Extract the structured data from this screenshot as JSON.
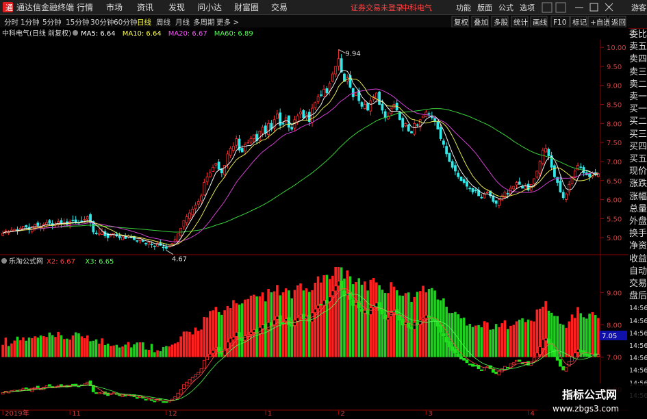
{
  "app": {
    "title": "通达信金融终端",
    "menu": [
      "行情",
      "市场",
      "资讯",
      "发现",
      "问小达",
      "财富圈",
      "交易"
    ],
    "notice": "证券交易未登录",
    "stock_name": "中科电气",
    "right_menu": [
      "功能",
      "版面",
      "公式",
      "选项"
    ],
    "user": "游客"
  },
  "toolbar": {
    "periods": [
      "分时",
      "1分钟",
      "5分钟",
      "15分钟",
      "30分钟",
      "60分钟",
      "日线",
      "周线",
      "月线",
      "多周期",
      "更多"
    ],
    "active_period": "日线",
    "tools": [
      "复权",
      "叠加",
      "多股",
      "统计",
      "画线",
      "F10",
      "标记",
      "+自选",
      "返回"
    ]
  },
  "legend_main": {
    "title": "中科电气(日线 前复权)",
    "items": [
      {
        "label": "MA5: 6.64",
        "color": "#ffffff"
      },
      {
        "label": "MA10: 6.64",
        "color": "#ffff55"
      },
      {
        "label": "MA20: 6.67",
        "color": "#ff55ff"
      },
      {
        "label": "MA60: 6.89",
        "color": "#55ff55"
      }
    ]
  },
  "legend_sub": {
    "title": "乐淘公式网",
    "items": [
      {
        "label": "X2: 6.67",
        "color": "#ff4444"
      },
      {
        "label": "X3: 6.65",
        "color": "#55ff55"
      }
    ],
    "current_value": "7.05"
  },
  "right_labels": [
    "委比",
    "卖五",
    "卖四",
    "卖三",
    "卖二",
    "卖一",
    "买一",
    "买二",
    "买三",
    "买四",
    "买五",
    "现价",
    "涨跌",
    "涨幅",
    "总量",
    "外盘",
    "换手",
    "净资",
    "收益",
    "自动",
    "交易",
    "盘后",
    "14:56",
    "14:56",
    "14:56",
    "14:56",
    "14:56",
    "14:56",
    "14:56",
    "14:56"
  ],
  "x_labels": [
    {
      "text": "2019年",
      "idx": 0
    },
    {
      "text": "11",
      "idx": 23
    },
    {
      "text": "12",
      "idx": 56
    },
    {
      "text": "1",
      "idx": 90
    },
    {
      "text": "2",
      "idx": 115
    },
    {
      "text": "3",
      "idx": 145
    },
    {
      "text": "4",
      "idx": 180
    }
  ],
  "chart_data": [
    {
      "type": "candlestick",
      "title": "中科电气(日线 前复权)",
      "ylim": [
        4.5,
        10.2
      ],
      "yticks": [
        5.0,
        5.5,
        6.0,
        6.5,
        7.0,
        7.5,
        8.0,
        8.5,
        9.0,
        9.5,
        10.0
      ],
      "annotations": [
        {
          "text": "9.94",
          "value": 9.94
        },
        {
          "text": "4.67",
          "value": 4.67
        }
      ],
      "close": [
        5.12,
        5.18,
        5.15,
        5.2,
        5.22,
        5.18,
        5.25,
        5.3,
        5.28,
        5.22,
        5.3,
        5.35,
        5.32,
        5.28,
        5.35,
        5.4,
        5.38,
        5.32,
        5.36,
        5.42,
        5.38,
        5.4,
        5.35,
        5.42,
        5.45,
        5.4,
        5.38,
        5.42,
        5.48,
        5.55,
        5.4,
        5.15,
        5.1,
        5.12,
        5.15,
        5.05,
        5.0,
        5.08,
        5.12,
        5.05,
        5.0,
        5.02,
        4.98,
        5.05,
        5.0,
        4.95,
        4.92,
        4.98,
        4.9,
        4.85,
        4.88,
        4.82,
        4.78,
        4.85,
        4.8,
        4.75,
        4.72,
        4.78,
        4.85,
        4.95,
        5.1,
        5.25,
        5.45,
        5.55,
        5.65,
        5.75,
        5.85,
        5.95,
        6.1,
        6.45,
        6.6,
        6.7,
        6.85,
        6.95,
        6.8,
        6.7,
        6.9,
        7.2,
        7.35,
        7.4,
        7.6,
        7.3,
        7.25,
        7.45,
        7.5,
        7.6,
        7.7,
        7.55,
        7.8,
        7.9,
        7.75,
        8.0,
        7.85,
        8.1,
        8.25,
        7.95,
        8.0,
        8.15,
        7.9,
        7.85,
        8.1,
        8.2,
        8.3,
        8.15,
        8.25,
        8.05,
        8.4,
        8.55,
        8.7,
        8.75,
        8.9,
        8.8,
        9.05,
        9.3,
        9.5,
        9.7,
        9.35,
        9.1,
        9.2,
        8.95,
        8.7,
        8.8,
        8.6,
        8.45,
        8.5,
        8.35,
        8.6,
        8.7,
        8.8,
        8.5,
        8.35,
        8.15,
        8.2,
        8.4,
        8.5,
        8.35,
        8.1,
        7.9,
        8.0,
        7.8,
        7.75,
        8.0,
        7.95,
        8.1,
        8.2,
        8.3,
        8.25,
        8.15,
        8.05,
        7.85,
        7.6,
        7.45,
        7.2,
        7.0,
        6.85,
        6.75,
        6.6,
        6.5,
        6.45,
        6.35,
        6.3,
        6.2,
        6.25,
        6.1,
        6.05,
        6.15,
        6.2,
        6.1,
        5.95,
        5.9,
        6.0,
        6.1,
        6.2,
        6.15,
        6.3,
        6.35,
        6.45,
        6.4,
        6.3,
        6.35,
        6.25,
        6.4,
        6.55,
        6.75,
        7.0,
        7.3,
        7.35,
        7.15,
        6.85,
        6.6,
        6.45,
        6.2,
        6.05,
        6.15,
        6.4,
        6.6,
        6.75,
        6.9,
        6.85,
        6.7,
        6.65,
        6.6,
        6.7,
        6.65,
        6.68
      ]
    },
    {
      "type": "bar",
      "title": "乐淘公式网",
      "ylim": [
        5.5,
        9.8
      ],
      "yticks": [
        6.0,
        7.0,
        8.0,
        9.0
      ],
      "series": [
        {
          "name": "X2",
          "value": 6.67
        },
        {
          "name": "X3",
          "value": 6.65
        }
      ]
    }
  ]
}
